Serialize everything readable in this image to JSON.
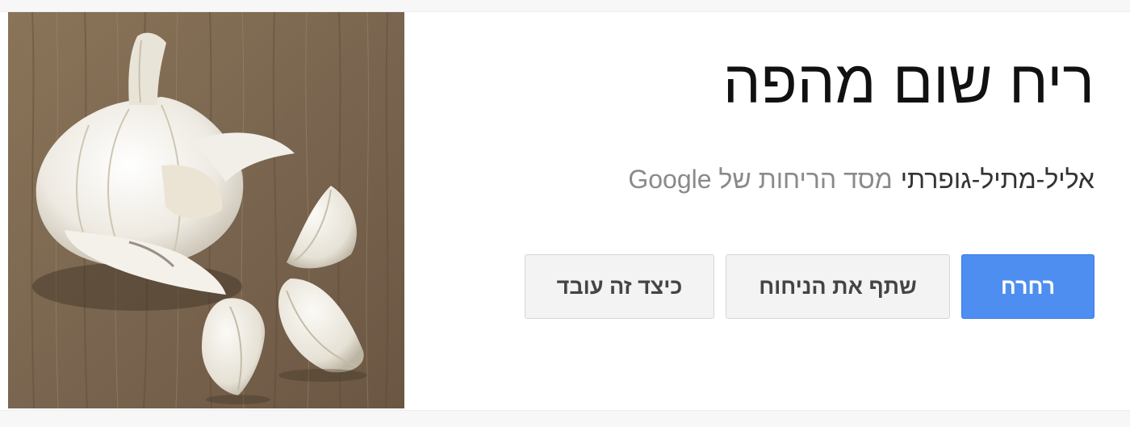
{
  "product": {
    "title": "ריח שום מהפה",
    "name": "אליל-מתיל-גופרתי",
    "maker": "מסד הריחות של Google"
  },
  "actions": {
    "sniff_label": "רחרח",
    "share_label": "שתף את הניחוח",
    "how_label": "כיצד זה עובד"
  },
  "image": {
    "subject": "garlic-bulb-and-cloves"
  },
  "colors": {
    "primary_button": "#4d8ef0",
    "secondary_button": "#f3f3f3",
    "title_text": "#111111",
    "muted_text": "#8a8a8a"
  }
}
